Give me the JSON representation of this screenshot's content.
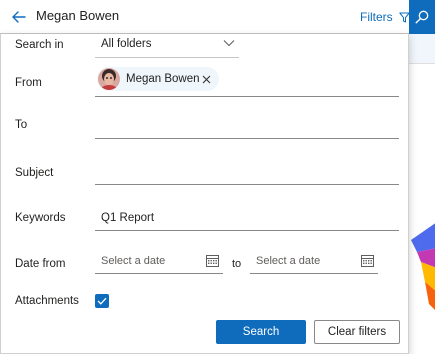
{
  "search": {
    "query": "Megan Bowen",
    "filters_label": "Filters"
  },
  "icons": {
    "back": "back-arrow-icon",
    "filter": "filter-icon",
    "search": "search-icon",
    "chevron": "chevron-down-icon",
    "remove": "close-icon",
    "calendar": "calendar-icon",
    "check": "checkmark-icon"
  },
  "filters": {
    "search_in": {
      "label": "Search in",
      "value": "All folders"
    },
    "from": {
      "label": "From",
      "chip_name": "Megan Bowen"
    },
    "to": {
      "label": "To",
      "value": ""
    },
    "subject": {
      "label": "Subject",
      "value": ""
    },
    "keywords": {
      "label": "Keywords",
      "value": "Q1 Report"
    },
    "date_from": {
      "label": "Date from",
      "start_placeholder": "Select a date",
      "to_label": "to",
      "end_placeholder": "Select a date"
    },
    "attachments": {
      "label": "Attachments",
      "checked": true
    }
  },
  "actions": {
    "search_label": "Search",
    "clear_label": "Clear filters"
  },
  "colors": {
    "accent": "#0f6cbd",
    "chip_bg": "#eff6fc"
  }
}
